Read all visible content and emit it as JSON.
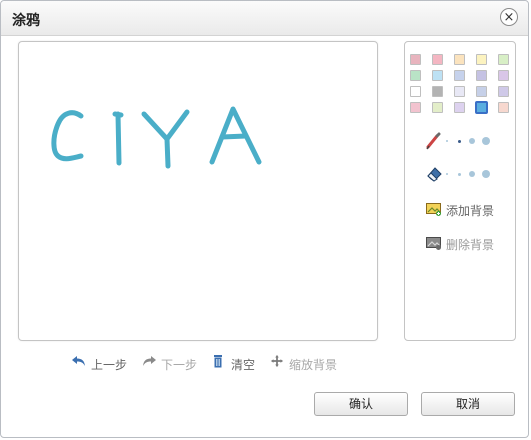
{
  "dialog": {
    "title": "涂鸦",
    "close_glyph": "×"
  },
  "palette": {
    "colors": [
      "#e8b4be",
      "#f4b6c2",
      "#fbe3be",
      "#fcf3c0",
      "#d8efc6",
      "#b9e3c6",
      "#bde1f4",
      "#c6d2ec",
      "#c5c2e3",
      "#d9c6e8",
      "#ffffff",
      "#b3b3b3",
      "#e8e8f5",
      "#c6d0e8",
      "#cfc9e8",
      "#f2c3cf",
      "#e3eec9",
      "#ddd2ef",
      "#5aaee0",
      "#f7d8cf"
    ],
    "selected_index": 18
  },
  "brush": {
    "sizes_count": 4,
    "selected_index": 1,
    "icon": "pencil-icon"
  },
  "eraser": {
    "sizes_count": 4,
    "selected_index": -1,
    "icon": "eraser-icon"
  },
  "background": {
    "add_label": "添加背景",
    "remove_label": "删除背景"
  },
  "toolbar": {
    "undo_label": "上一步",
    "redo_label": "下一步",
    "clear_label": "清空",
    "scale_label": "缩放背景"
  },
  "buttons": {
    "confirm_label": "确认",
    "cancel_label": "取消"
  },
  "drawing": {
    "stroke_color": "#4aaec8",
    "text": "CIYA"
  }
}
